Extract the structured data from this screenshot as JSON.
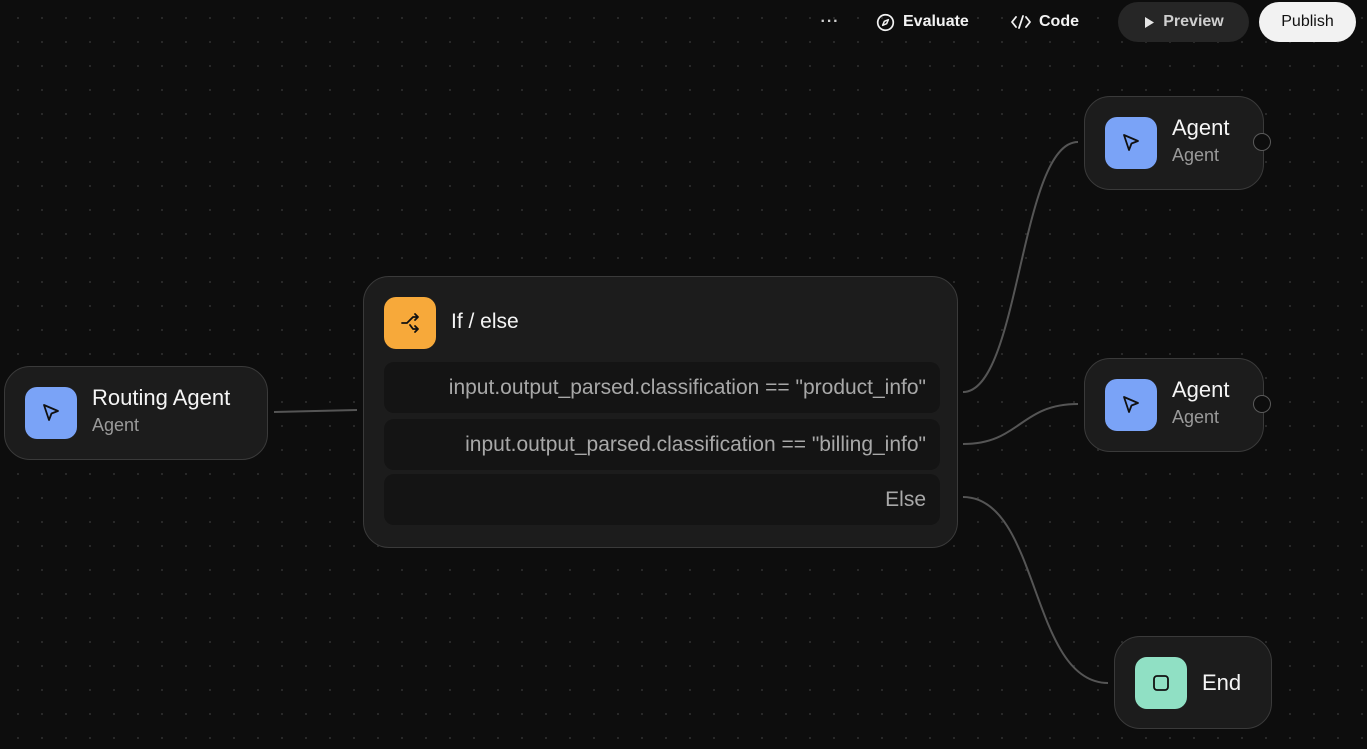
{
  "toolbar": {
    "more_label": "···",
    "evaluate_label": "Evaluate",
    "code_label": "Code",
    "preview_label": "Preview",
    "publish_label": "Publish"
  },
  "nodes": {
    "routing_agent": {
      "title": "Routing Agent",
      "subtitle": "Agent",
      "icon": "cursor-icon"
    },
    "if_else": {
      "title": "If / else",
      "icon": "branch-icon",
      "conditions": [
        "input.output_parsed.classification == \"product_info\"",
        "input.output_parsed.classification == \"billing_info\"",
        "Else"
      ]
    },
    "agent_1": {
      "title": "Agent",
      "subtitle": "Agent",
      "icon": "cursor-icon"
    },
    "agent_2": {
      "title": "Agent",
      "subtitle": "Agent",
      "icon": "cursor-icon"
    },
    "end": {
      "title": "End",
      "icon": "stop-icon"
    }
  },
  "colors": {
    "background": "#0d0d0d",
    "node_bg": "#1c1c1c",
    "agent_icon": "#7aa3f7",
    "if_else_icon": "#f7a93a",
    "end_icon": "#90e0c4"
  }
}
